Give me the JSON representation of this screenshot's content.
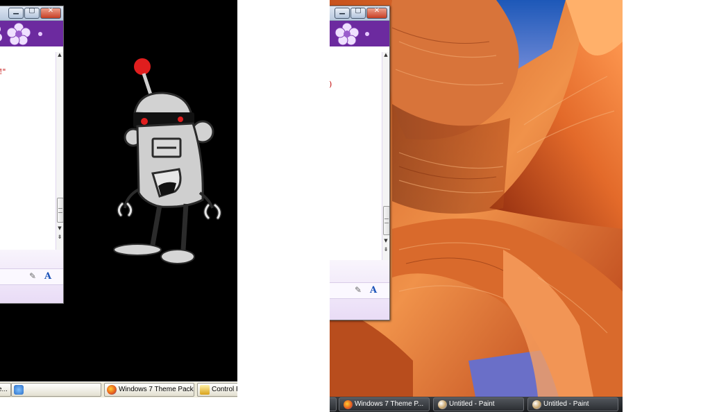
{
  "left_panel": {
    "theme": "robot",
    "window": {
      "title_buttons": [
        "minimize",
        "maximize",
        "close"
      ],
      "conversation_fragment": "!\"",
      "icons": [
        "flower-icon",
        "pen-icon",
        "font-icon"
      ]
    },
    "taskbar": {
      "buttons": [
        {
          "label": "Windows 7 Theme Pack...",
          "icon": "firefox-icon"
        },
        {
          "label": "Control Pa",
          "icon": "control-panel-icon"
        }
      ],
      "partial_left_label": "e...",
      "colors": {
        "bar": "#ece9d8"
      }
    }
  },
  "right_panel": {
    "theme": "canyon",
    "window": {
      "title_buttons": [
        "minimize",
        "maximize",
        "close"
      ],
      "conversation_fragment": ")",
      "icons": [
        "flower-icon",
        "pen-icon",
        "font-icon"
      ]
    },
    "taskbar": {
      "buttons": [
        {
          "label": "Windows 7 Theme P...",
          "icon": "firefox-icon"
        },
        {
          "label": "Untitled - Paint",
          "icon": "paint-icon"
        },
        {
          "label": "Untitled - Paint",
          "icon": "paint-icon"
        }
      ],
      "colors": {
        "bar": "#1c1e21"
      }
    }
  },
  "colors": {
    "header_purple": "#6c2a9f",
    "red_text": "#c00000",
    "robot_red": "#e01e1e",
    "robot_grey": "#cfcfcf"
  }
}
